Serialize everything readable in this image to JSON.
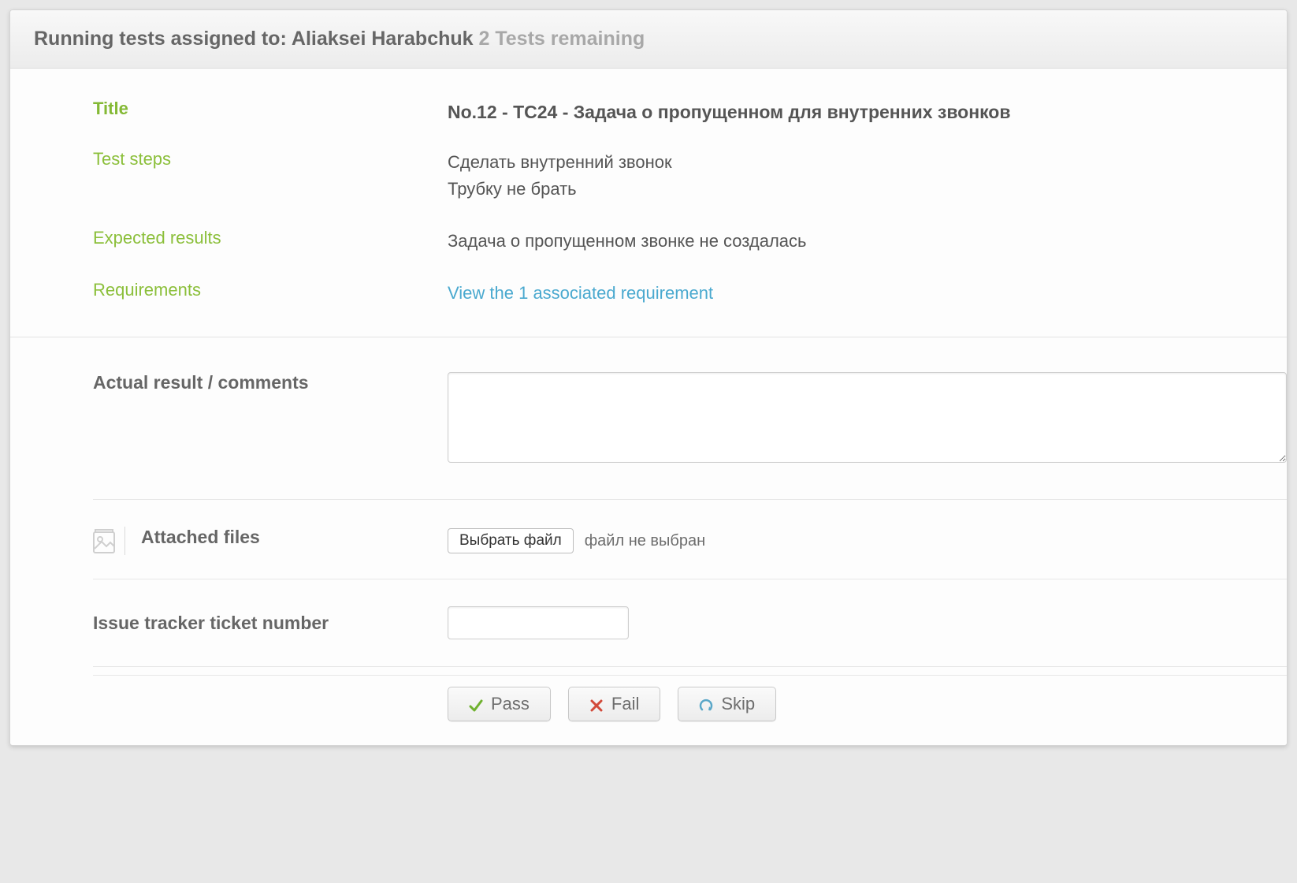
{
  "header": {
    "prefix": "Running tests assigned to:",
    "assignee": "Aliaksei Harabchuk",
    "remaining": "2 Tests remaining"
  },
  "labels": {
    "title": "Title",
    "test_steps": "Test steps",
    "expected_results": "Expected results",
    "requirements": "Requirements",
    "actual_result": "Actual result / comments",
    "attached_files": "Attached files",
    "issue_tracker": "Issue tracker ticket number"
  },
  "values": {
    "title": "No.12 - TC24 - Задача о пропущенном для внутренних звонков",
    "test_steps_line1": "Сделать внутренний звонок",
    "test_steps_line2": "Трубку не брать",
    "expected_results": "Задача о пропущенном звонке не создалась",
    "requirements_link": "View the 1 associated requirement"
  },
  "file": {
    "button": "Выбрать файл",
    "status": "файл не выбран"
  },
  "actions": {
    "pass": "Pass",
    "fail": "Fail",
    "skip": "Skip"
  },
  "inputs": {
    "comments_value": "",
    "ticket_value": ""
  }
}
